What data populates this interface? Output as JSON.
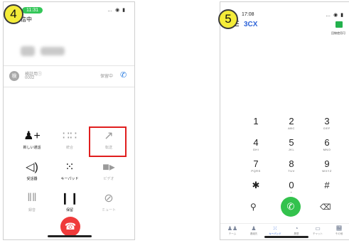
{
  "steps": {
    "left": "4",
    "right": "5"
  },
  "phone4": {
    "status_pill": "11:31",
    "status_icons": "… ◉ ▮",
    "header_label": "発信中",
    "held_call": {
      "avatar": "検",
      "name": "検証用①",
      "number": "0002",
      "status": "保留中"
    },
    "actions": [
      {
        "label": "新しい通話",
        "icon": "add-call-icon",
        "glyph": "♟+",
        "dim": false
      },
      {
        "label": "統合",
        "icon": "merge-icon",
        "glyph": "∷∷",
        "dim": true
      },
      {
        "label": "転送",
        "icon": "transfer-icon",
        "glyph": "↗",
        "dim": true
      },
      {
        "label": "受話器",
        "icon": "speaker-icon",
        "glyph": "◁)",
        "dim": false
      },
      {
        "label": "キーパッド",
        "icon": "keypad-icon",
        "glyph": "⁙",
        "dim": false
      },
      {
        "label": "ビデオ",
        "icon": "video-icon",
        "glyph": "■▸",
        "dim": true
      },
      {
        "label": "録音",
        "icon": "record-icon",
        "glyph": "‖‖",
        "dim": true
      },
      {
        "label": "保留",
        "icon": "hold-icon",
        "glyph": "❙❙",
        "dim": false
      },
      {
        "label": "ミュート",
        "icon": "mute-icon",
        "glyph": "⊘",
        "dim": true
      }
    ]
  },
  "phone5": {
    "time": "17:08",
    "status_icons": "… ◉ ▮",
    "logo_prefix": "3C",
    "logo_suffix": "X",
    "status_label": "回線使用可",
    "keys": [
      {
        "digit": "1",
        "letters": ""
      },
      {
        "digit": "2",
        "letters": "ABC"
      },
      {
        "digit": "3",
        "letters": "DEF"
      },
      {
        "digit": "4",
        "letters": "GHI"
      },
      {
        "digit": "5",
        "letters": "JKL"
      },
      {
        "digit": "6",
        "letters": "MNO"
      },
      {
        "digit": "7",
        "letters": "PQRS"
      },
      {
        "digit": "8",
        "letters": "TUV"
      },
      {
        "digit": "9",
        "letters": "WXYZ"
      },
      {
        "digit": "✱",
        "letters": ""
      },
      {
        "digit": "0",
        "letters": "+"
      },
      {
        "digit": "#",
        "letters": ""
      }
    ],
    "tabs": [
      {
        "label": "チーム",
        "icon": "team-icon",
        "glyph": "♟♟"
      },
      {
        "label": "連絡先",
        "icon": "contacts-icon",
        "glyph": "♟"
      },
      {
        "label": "キーパッド",
        "icon": "keypad-tab-icon",
        "glyph": "⁙"
      },
      {
        "label": "履歴",
        "icon": "history-icon",
        "glyph": "◔"
      },
      {
        "label": "チャット",
        "icon": "chat-icon",
        "glyph": "▭"
      },
      {
        "label": "その他",
        "icon": "voicemail-icon",
        "glyph": "଀"
      }
    ],
    "active_tab": 2
  }
}
